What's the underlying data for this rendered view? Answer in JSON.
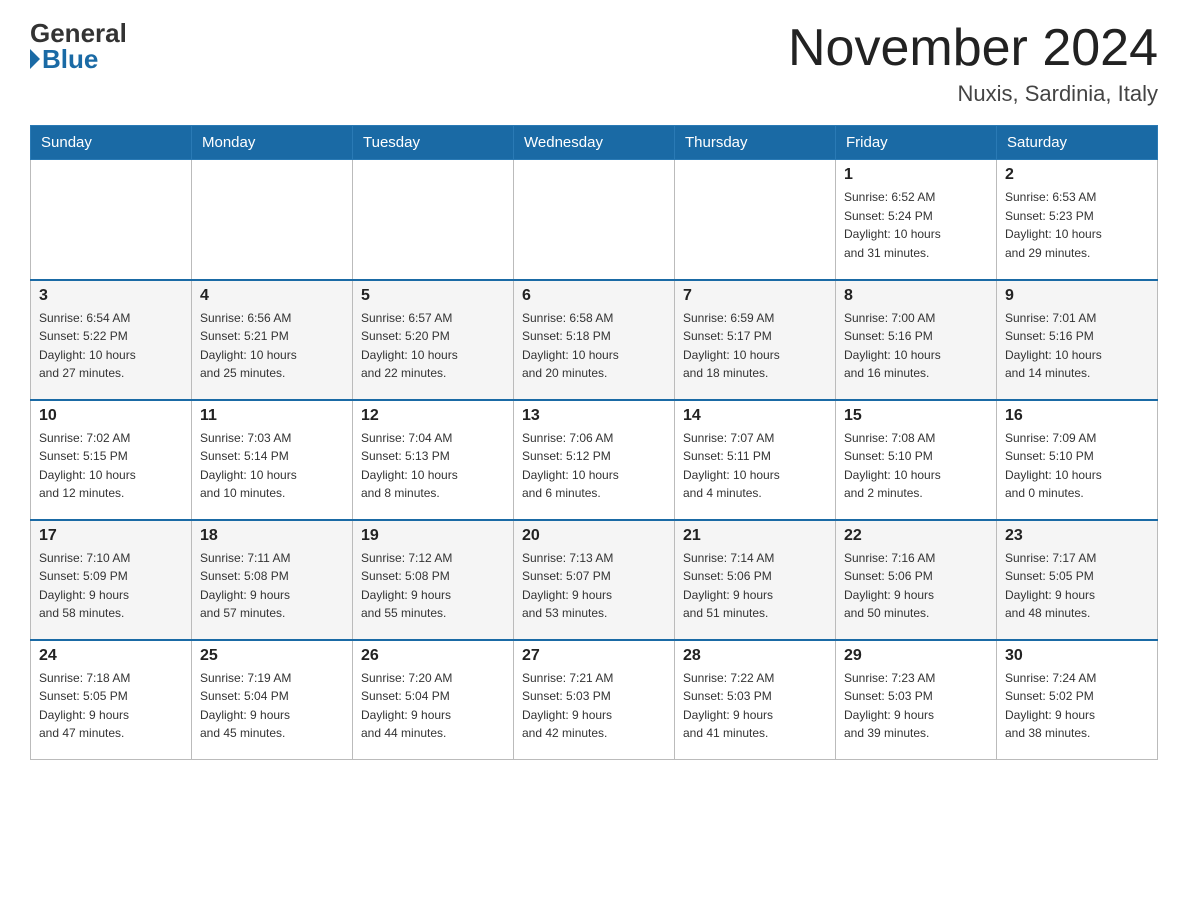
{
  "logo": {
    "general": "General",
    "blue": "Blue"
  },
  "title": {
    "month_year": "November 2024",
    "location": "Nuxis, Sardinia, Italy"
  },
  "weekdays": [
    "Sunday",
    "Monday",
    "Tuesday",
    "Wednesday",
    "Thursday",
    "Friday",
    "Saturday"
  ],
  "weeks": [
    [
      {
        "day": "",
        "info": ""
      },
      {
        "day": "",
        "info": ""
      },
      {
        "day": "",
        "info": ""
      },
      {
        "day": "",
        "info": ""
      },
      {
        "day": "",
        "info": ""
      },
      {
        "day": "1",
        "info": "Sunrise: 6:52 AM\nSunset: 5:24 PM\nDaylight: 10 hours\nand 31 minutes."
      },
      {
        "day": "2",
        "info": "Sunrise: 6:53 AM\nSunset: 5:23 PM\nDaylight: 10 hours\nand 29 minutes."
      }
    ],
    [
      {
        "day": "3",
        "info": "Sunrise: 6:54 AM\nSunset: 5:22 PM\nDaylight: 10 hours\nand 27 minutes."
      },
      {
        "day": "4",
        "info": "Sunrise: 6:56 AM\nSunset: 5:21 PM\nDaylight: 10 hours\nand 25 minutes."
      },
      {
        "day": "5",
        "info": "Sunrise: 6:57 AM\nSunset: 5:20 PM\nDaylight: 10 hours\nand 22 minutes."
      },
      {
        "day": "6",
        "info": "Sunrise: 6:58 AM\nSunset: 5:18 PM\nDaylight: 10 hours\nand 20 minutes."
      },
      {
        "day": "7",
        "info": "Sunrise: 6:59 AM\nSunset: 5:17 PM\nDaylight: 10 hours\nand 18 minutes."
      },
      {
        "day": "8",
        "info": "Sunrise: 7:00 AM\nSunset: 5:16 PM\nDaylight: 10 hours\nand 16 minutes."
      },
      {
        "day": "9",
        "info": "Sunrise: 7:01 AM\nSunset: 5:16 PM\nDaylight: 10 hours\nand 14 minutes."
      }
    ],
    [
      {
        "day": "10",
        "info": "Sunrise: 7:02 AM\nSunset: 5:15 PM\nDaylight: 10 hours\nand 12 minutes."
      },
      {
        "day": "11",
        "info": "Sunrise: 7:03 AM\nSunset: 5:14 PM\nDaylight: 10 hours\nand 10 minutes."
      },
      {
        "day": "12",
        "info": "Sunrise: 7:04 AM\nSunset: 5:13 PM\nDaylight: 10 hours\nand 8 minutes."
      },
      {
        "day": "13",
        "info": "Sunrise: 7:06 AM\nSunset: 5:12 PM\nDaylight: 10 hours\nand 6 minutes."
      },
      {
        "day": "14",
        "info": "Sunrise: 7:07 AM\nSunset: 5:11 PM\nDaylight: 10 hours\nand 4 minutes."
      },
      {
        "day": "15",
        "info": "Sunrise: 7:08 AM\nSunset: 5:10 PM\nDaylight: 10 hours\nand 2 minutes."
      },
      {
        "day": "16",
        "info": "Sunrise: 7:09 AM\nSunset: 5:10 PM\nDaylight: 10 hours\nand 0 minutes."
      }
    ],
    [
      {
        "day": "17",
        "info": "Sunrise: 7:10 AM\nSunset: 5:09 PM\nDaylight: 9 hours\nand 58 minutes."
      },
      {
        "day": "18",
        "info": "Sunrise: 7:11 AM\nSunset: 5:08 PM\nDaylight: 9 hours\nand 57 minutes."
      },
      {
        "day": "19",
        "info": "Sunrise: 7:12 AM\nSunset: 5:08 PM\nDaylight: 9 hours\nand 55 minutes."
      },
      {
        "day": "20",
        "info": "Sunrise: 7:13 AM\nSunset: 5:07 PM\nDaylight: 9 hours\nand 53 minutes."
      },
      {
        "day": "21",
        "info": "Sunrise: 7:14 AM\nSunset: 5:06 PM\nDaylight: 9 hours\nand 51 minutes."
      },
      {
        "day": "22",
        "info": "Sunrise: 7:16 AM\nSunset: 5:06 PM\nDaylight: 9 hours\nand 50 minutes."
      },
      {
        "day": "23",
        "info": "Sunrise: 7:17 AM\nSunset: 5:05 PM\nDaylight: 9 hours\nand 48 minutes."
      }
    ],
    [
      {
        "day": "24",
        "info": "Sunrise: 7:18 AM\nSunset: 5:05 PM\nDaylight: 9 hours\nand 47 minutes."
      },
      {
        "day": "25",
        "info": "Sunrise: 7:19 AM\nSunset: 5:04 PM\nDaylight: 9 hours\nand 45 minutes."
      },
      {
        "day": "26",
        "info": "Sunrise: 7:20 AM\nSunset: 5:04 PM\nDaylight: 9 hours\nand 44 minutes."
      },
      {
        "day": "27",
        "info": "Sunrise: 7:21 AM\nSunset: 5:03 PM\nDaylight: 9 hours\nand 42 minutes."
      },
      {
        "day": "28",
        "info": "Sunrise: 7:22 AM\nSunset: 5:03 PM\nDaylight: 9 hours\nand 41 minutes."
      },
      {
        "day": "29",
        "info": "Sunrise: 7:23 AM\nSunset: 5:03 PM\nDaylight: 9 hours\nand 39 minutes."
      },
      {
        "day": "30",
        "info": "Sunrise: 7:24 AM\nSunset: 5:02 PM\nDaylight: 9 hours\nand 38 minutes."
      }
    ]
  ]
}
